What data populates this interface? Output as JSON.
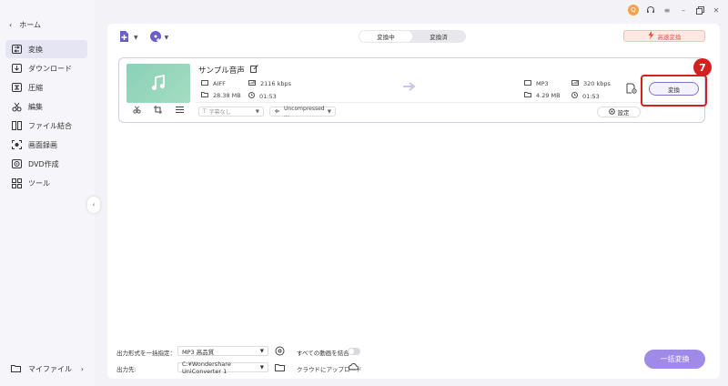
{
  "sidebar": {
    "home_label": "ホーム",
    "items": [
      {
        "label": "変換",
        "icon": "convert-icon",
        "active": true
      },
      {
        "label": "ダウンロード",
        "icon": "download-icon"
      },
      {
        "label": "圧縮",
        "icon": "compress-icon"
      },
      {
        "label": "編集",
        "icon": "edit-scissors-icon"
      },
      {
        "label": "ファイル結合",
        "icon": "merge-icon"
      },
      {
        "label": "画面録画",
        "icon": "screen-record-icon"
      },
      {
        "label": "DVD作成",
        "icon": "dvd-icon"
      },
      {
        "label": "ツール",
        "icon": "tools-icon"
      }
    ],
    "bottom_label": "マイファイル"
  },
  "titlebar": {
    "avatar_text": "Q"
  },
  "tabs": {
    "converting": "変換中",
    "converted": "変換済"
  },
  "speed_button": "高速変換",
  "file": {
    "name": "サンプル音声",
    "source": {
      "format": "AIFF",
      "bitrate": "2116 kbps",
      "size": "28.38 MB",
      "duration": "01:53"
    },
    "target": {
      "format": "MP3",
      "bitrate": "320 kbps",
      "size": "4.29 MB",
      "duration": "01:53"
    },
    "subtitle_placeholder": "字幕なし",
    "audio_track": "Uncompressed ...",
    "settings_label": "設定",
    "convert_label": "変換"
  },
  "annotation": {
    "step": "7",
    "color": "#d61f1f"
  },
  "footer": {
    "output_format_label": "出力形式を一括指定：",
    "output_format_value": "MP3 高品質",
    "merge_label": "すべての動画を結合",
    "output_dir_label": "出力先:",
    "output_dir_value": "C:¥Wondershare UniConverter 1",
    "upload_label": "クラウドにアップロード",
    "convert_all_label": "一括変換"
  },
  "colors": {
    "accent": "#a08ae8",
    "highlight": "#d61f1f",
    "speed": "#e0573a"
  }
}
